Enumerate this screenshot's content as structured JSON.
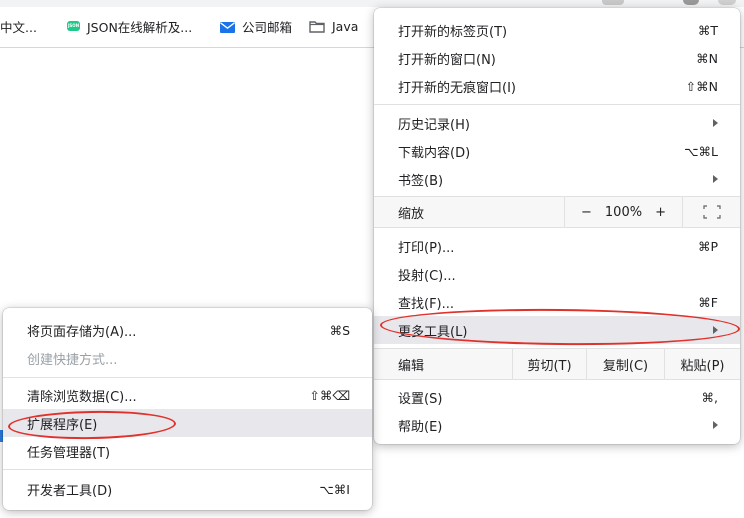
{
  "bookmarks": {
    "items": [
      {
        "icon": "text-truncated",
        "label": "中文..."
      },
      {
        "icon": "json-icon",
        "label": "JSON在线解析及..."
      },
      {
        "icon": "mail-icon",
        "label": "公司邮箱"
      },
      {
        "icon": "folder-icon",
        "label": "Java"
      }
    ]
  },
  "main_menu": {
    "new_tab": {
      "label": "打开新的标签页(T)",
      "shortcut": "⌘T"
    },
    "new_window": {
      "label": "打开新的窗口(N)",
      "shortcut": "⌘N"
    },
    "new_incognito": {
      "label": "打开新的无痕窗口(I)",
      "shortcut": "⇧⌘N"
    },
    "history": {
      "label": "历史记录(H)"
    },
    "downloads": {
      "label": "下载内容(D)",
      "shortcut": "⌥⌘L"
    },
    "bookmarks": {
      "label": "书签(B)"
    },
    "zoom": {
      "label": "缩放",
      "minus": "−",
      "value": "100%",
      "plus": "+"
    },
    "print": {
      "label": "打印(P)...",
      "shortcut": "⌘P"
    },
    "cast": {
      "label": "投射(C)..."
    },
    "find": {
      "label": "查找(F)...",
      "shortcut": "⌘F"
    },
    "more_tools": {
      "label": "更多工具(L)"
    },
    "edit": {
      "label": "编辑",
      "cut": "剪切(T)",
      "copy": "复制(C)",
      "paste": "粘贴(P)"
    },
    "settings": {
      "label": "设置(S)",
      "shortcut": "⌘,"
    },
    "help": {
      "label": "帮助(E)"
    }
  },
  "submenu": {
    "save_page": {
      "label": "将页面存储为(A)...",
      "shortcut": "⌘S"
    },
    "create_shortcut": {
      "label": "创建快捷方式..."
    },
    "clear_data": {
      "label": "清除浏览数据(C)...",
      "shortcut": "⇧⌘⌫"
    },
    "extensions": {
      "label": "扩展程序(E)"
    },
    "task_manager": {
      "label": "任务管理器(T)"
    },
    "dev_tools": {
      "label": "开发者工具(D)",
      "shortcut": "⌥⌘I"
    }
  },
  "colors": {
    "annotation_ring": "#e0312c",
    "highlight": "#e8e8ec"
  }
}
